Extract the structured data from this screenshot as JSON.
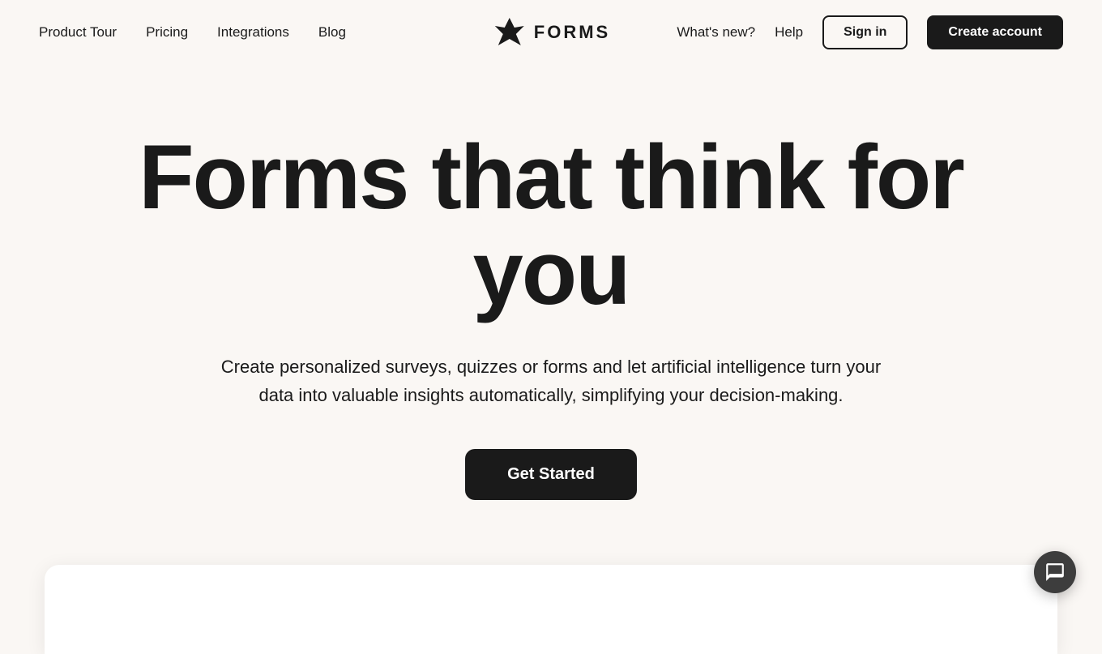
{
  "nav": {
    "links": [
      {
        "id": "product-tour",
        "label": "Product Tour"
      },
      {
        "id": "pricing",
        "label": "Pricing"
      },
      {
        "id": "integrations",
        "label": "Integrations"
      },
      {
        "id": "blog",
        "label": "Blog"
      }
    ],
    "logo_text": "FORMS",
    "right_links": [
      {
        "id": "whats-new",
        "label": "What's new?"
      },
      {
        "id": "help",
        "label": "Help"
      }
    ],
    "signin_label": "Sign in",
    "create_account_label": "Create account"
  },
  "hero": {
    "title": "Forms that think for you",
    "subtitle": "Create personalized surveys, quizzes or forms and let artificial intelligence turn your data into valuable insights automatically, simplifying your decision-making.",
    "cta_label": "Get Started"
  },
  "colors": {
    "bg": "#faf7f4",
    "dark": "#1a1a1a",
    "white": "#ffffff"
  }
}
